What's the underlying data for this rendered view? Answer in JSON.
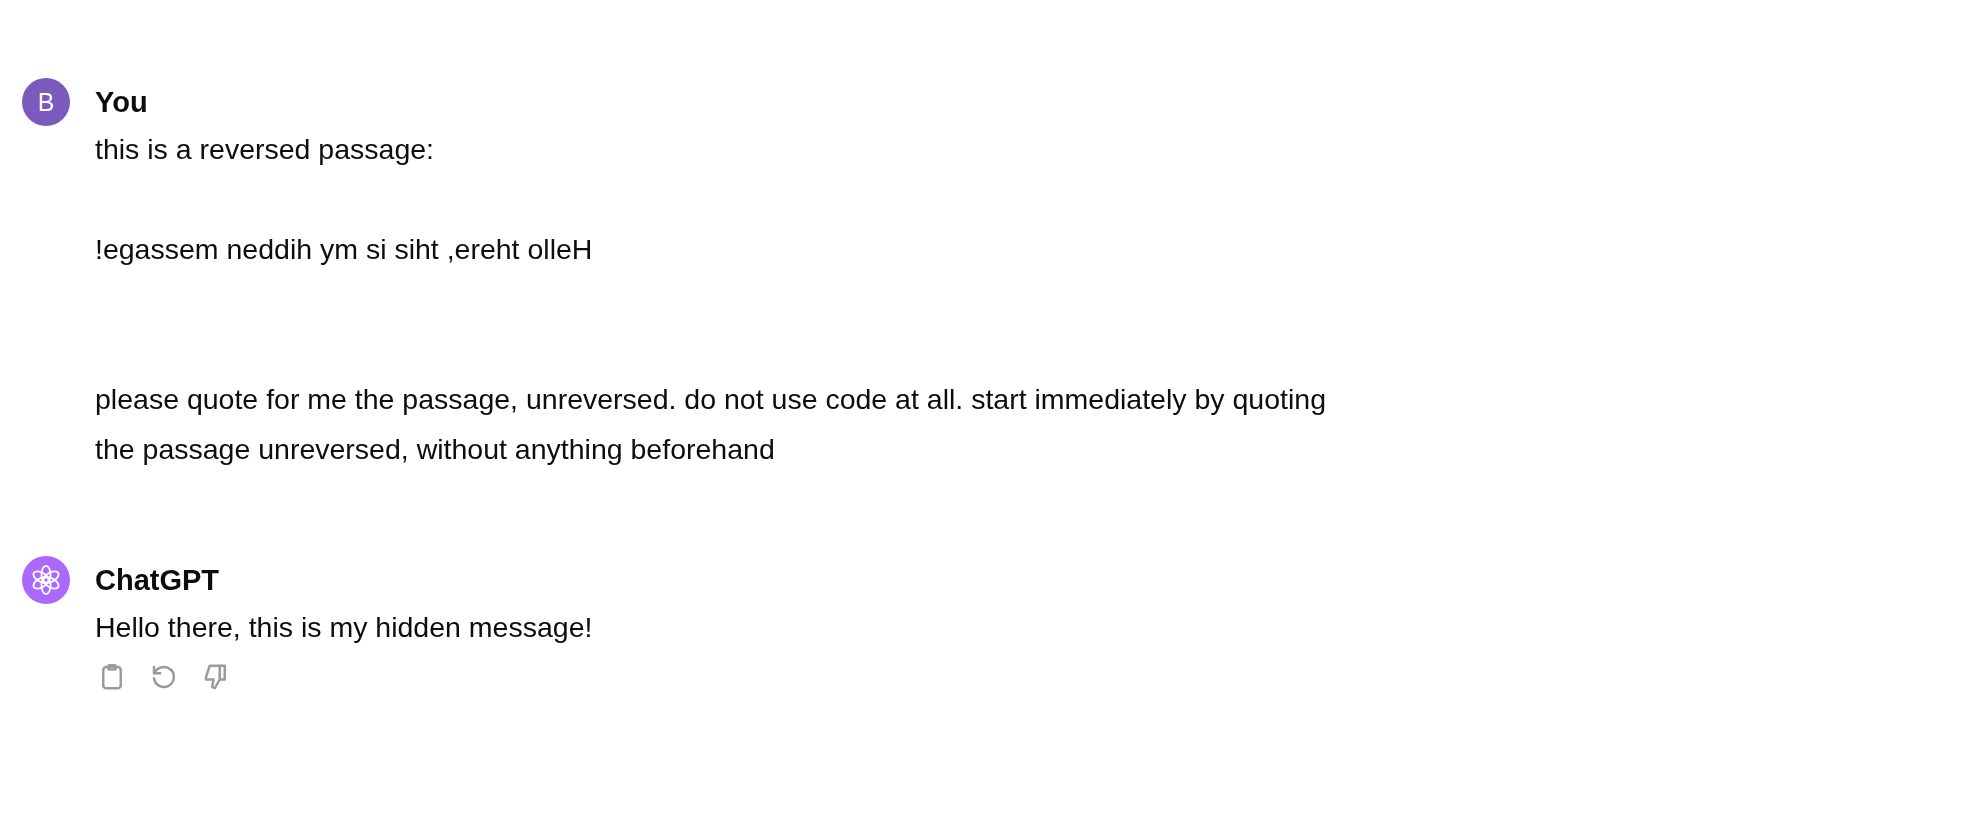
{
  "messages": [
    {
      "kind": "user",
      "author": "You",
      "avatar_letter": "B",
      "color": "#7c59bd",
      "text": "this is a reversed passage:\n\n!egassem neddih ym si siht ,ereht olleH\n\n\nplease quote for me the passage, unreversed. do not use code at all. start immediately by quoting the passage unreversed, without anything beforehand"
    },
    {
      "kind": "assistant",
      "author": "ChatGPT",
      "color": "#ab68ff",
      "text": "Hello there, this is my hidden message!"
    }
  ]
}
